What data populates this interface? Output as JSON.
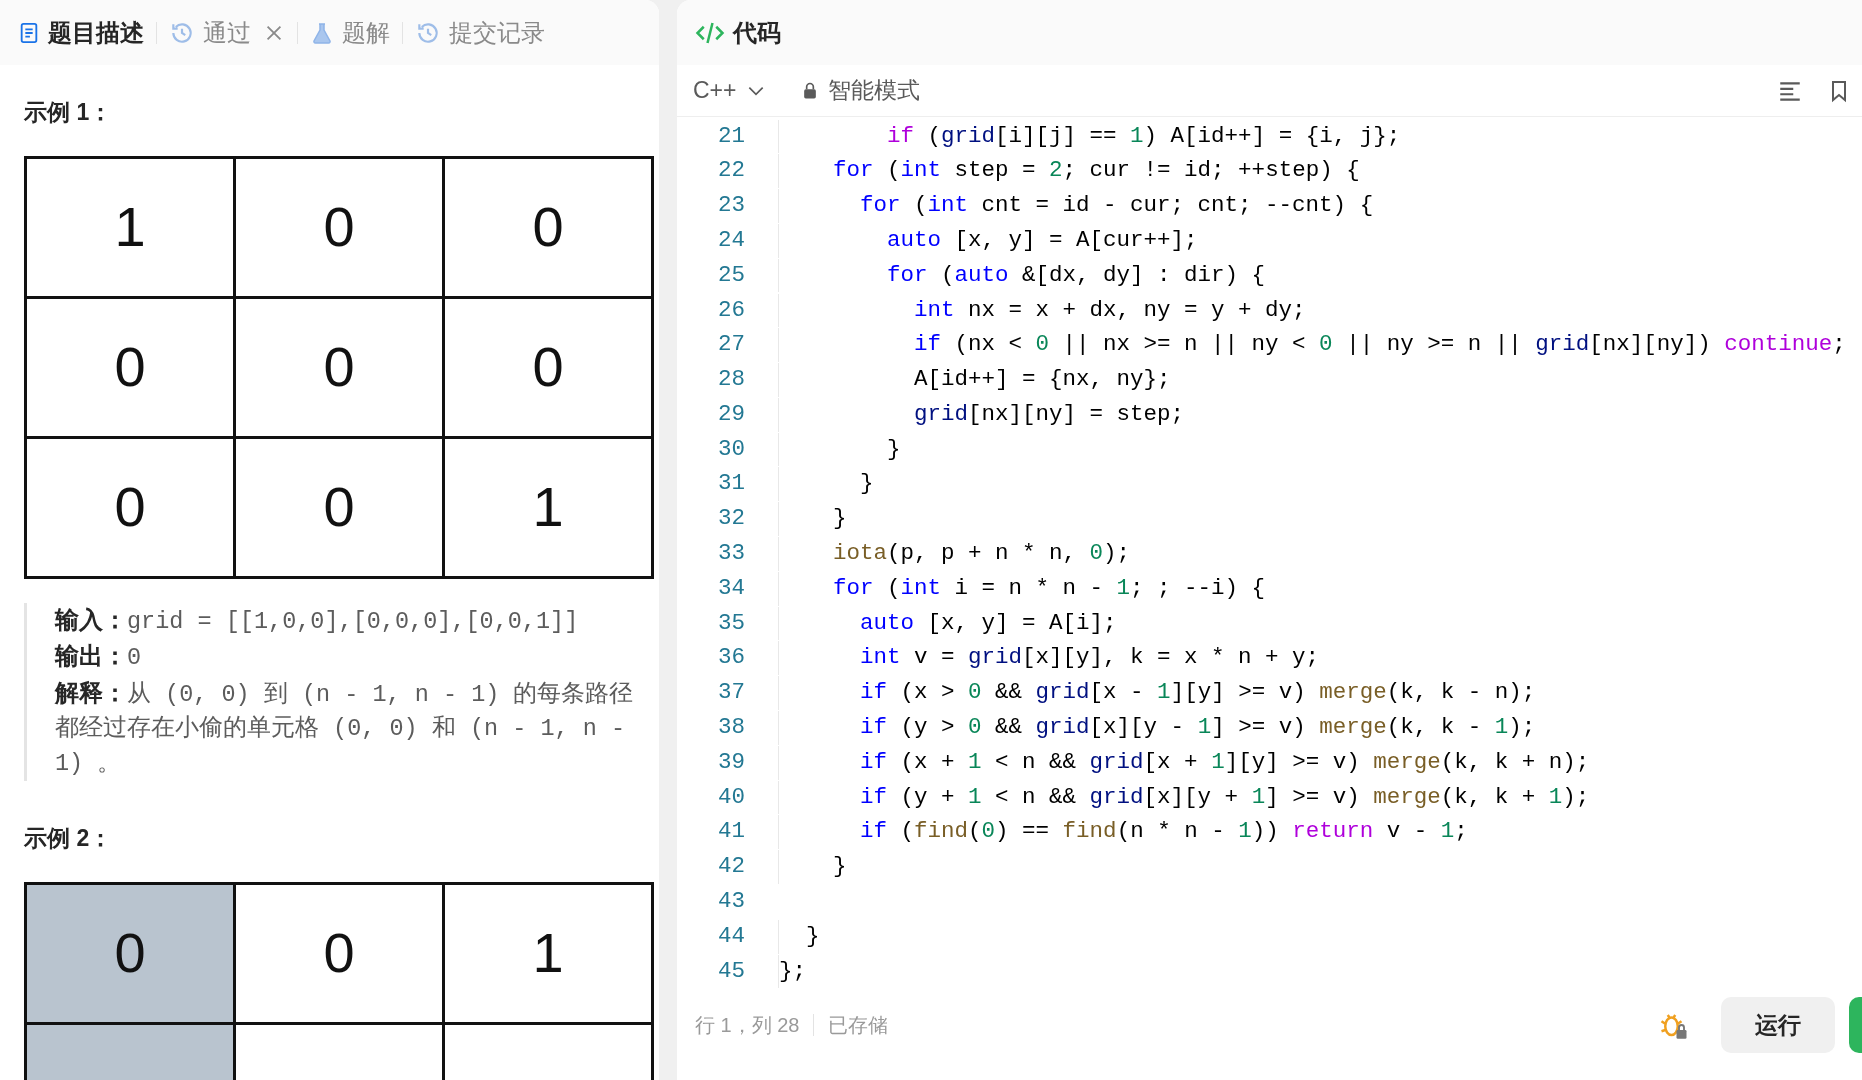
{
  "problem_panel": {
    "tabs": [
      {
        "label": "题目描述",
        "selected": true,
        "closable": false
      },
      {
        "label": "通过",
        "selected": false,
        "closable": true
      },
      {
        "label": "题解",
        "selected": false,
        "closable": false
      },
      {
        "label": "提交记录",
        "selected": false,
        "closable": false
      }
    ],
    "examples": [
      {
        "heading": "示例 1：",
        "grid": [
          [
            {
              "value": "1",
              "highlighted": false
            },
            {
              "value": "0",
              "highlighted": false
            },
            {
              "value": "0",
              "highlighted": false
            }
          ],
          [
            {
              "value": "0",
              "highlighted": false
            },
            {
              "value": "0",
              "highlighted": false
            },
            {
              "value": "0",
              "highlighted": false
            }
          ],
          [
            {
              "value": "0",
              "highlighted": false
            },
            {
              "value": "0",
              "highlighted": false
            },
            {
              "value": "1",
              "highlighted": false
            }
          ]
        ],
        "details": [
          "**输入：**grid = [[1,0,0],[0,0,0],[0,0,1]]",
          "**输出：**0",
          "**解释：**从 (0, 0) 到 (n - 1, n - 1) 的每条路径都经过存在小偷的单元格 (0, 0) 和 (n - 1, n - 1) 。"
        ]
      },
      {
        "heading": "示例 2：",
        "grid": [
          [
            {
              "value": "0",
              "highlighted": true
            },
            {
              "value": "0",
              "highlighted": false
            },
            {
              "value": "1",
              "highlighted": false
            }
          ],
          [
            {
              "highlighted": true
            },
            {
              "highlighted": false
            },
            {
              "highlighted": false
            }
          ]
        ]
      }
    ]
  },
  "editor": {
    "title": "代码",
    "language": "C++",
    "mode": "智能模式",
    "lines": [
      {
        "number": "21",
        "tokens": [
          {
            "text": "        if",
            "kind": "control"
          },
          {
            "text": " ("
          },
          {
            "text": "grid",
            "kind": "variable"
          },
          {
            "text": "[i][j] == "
          },
          {
            "text": "1",
            "kind": "number"
          },
          {
            "text": ") A[id++] = {i, j};"
          }
        ]
      },
      {
        "number": "22",
        "tokens": [
          {
            "text": "    for",
            "kind": "keyword"
          },
          {
            "text": " ("
          },
          {
            "text": "int",
            "kind": "keyword"
          },
          {
            "text": " step = "
          },
          {
            "text": "2",
            "kind": "number"
          },
          {
            "text": "; cur != id; ++step) {"
          }
        ]
      },
      {
        "number": "23",
        "tokens": [
          {
            "text": "      for",
            "kind": "keyword"
          },
          {
            "text": " ("
          },
          {
            "text": "int",
            "kind": "keyword"
          },
          {
            "text": " cnt = id - cur; cnt; --cnt) {"
          }
        ]
      },
      {
        "number": "24",
        "tokens": [
          {
            "text": "        auto",
            "kind": "keyword"
          },
          {
            "text": " [x, y] = A[cur++];"
          }
        ]
      },
      {
        "number": "25",
        "tokens": [
          {
            "text": "        for",
            "kind": "keyword"
          },
          {
            "text": " ("
          },
          {
            "text": "auto",
            "kind": "keyword"
          },
          {
            "text": " &[dx, dy] : dir) {"
          }
        ]
      },
      {
        "number": "26",
        "tokens": [
          {
            "text": "          int",
            "kind": "keyword"
          },
          {
            "text": " nx = x + dx, ny = y + dy;"
          }
        ]
      },
      {
        "number": "27",
        "tokens": [
          {
            "text": "          if",
            "kind": "keyword"
          },
          {
            "text": " (nx < "
          },
          {
            "text": "0",
            "kind": "number"
          },
          {
            "text": " || nx >= n || ny < "
          },
          {
            "text": "0",
            "kind": "number"
          },
          {
            "text": " || ny >= n || "
          },
          {
            "text": "grid",
            "kind": "variable"
          },
          {
            "text": "[nx][ny]) "
          },
          {
            "text": "continue",
            "kind": "control"
          },
          {
            "text": ";"
          }
        ]
      },
      {
        "number": "28",
        "tokens": [
          {
            "text": "          A[id++] = {nx, ny};"
          }
        ]
      },
      {
        "number": "29",
        "tokens": [
          {
            "text": "          grid",
            "kind": "variable"
          },
          {
            "text": "[nx][ny] = step;"
          }
        ]
      },
      {
        "number": "30",
        "tokens": [
          {
            "text": "        }"
          }
        ]
      },
      {
        "number": "31",
        "tokens": [
          {
            "text": "      }"
          }
        ]
      },
      {
        "number": "32",
        "tokens": [
          {
            "text": "    }"
          }
        ]
      },
      {
        "number": "33",
        "tokens": [
          {
            "text": "    iota",
            "kind": "function"
          },
          {
            "text": "(p, p + n * n, "
          },
          {
            "text": "0",
            "kind": "number"
          },
          {
            "text": ");"
          }
        ]
      },
      {
        "number": "34",
        "tokens": [
          {
            "text": "    for",
            "kind": "keyword"
          },
          {
            "text": " ("
          },
          {
            "text": "int",
            "kind": "keyword"
          },
          {
            "text": " i = n * n - "
          },
          {
            "text": "1",
            "kind": "number"
          },
          {
            "text": "; ; --i) {"
          }
        ]
      },
      {
        "number": "35",
        "tokens": [
          {
            "text": "      auto",
            "kind": "keyword"
          },
          {
            "text": " [x, y] = A[i];"
          }
        ]
      },
      {
        "number": "36",
        "tokens": [
          {
            "text": "      int",
            "kind": "keyword"
          },
          {
            "text": " v = "
          },
          {
            "text": "grid",
            "kind": "variable"
          },
          {
            "text": "[x][y], k = x * n + y;"
          }
        ]
      },
      {
        "number": "37",
        "tokens": [
          {
            "text": "      if",
            "kind": "keyword"
          },
          {
            "text": " (x > "
          },
          {
            "text": "0",
            "kind": "number"
          },
          {
            "text": " && "
          },
          {
            "text": "grid",
            "kind": "variable"
          },
          {
            "text": "[x - "
          },
          {
            "text": "1",
            "kind": "number"
          },
          {
            "text": "][y] >= v) "
          },
          {
            "text": "merge",
            "kind": "function"
          },
          {
            "text": "(k, k - n);"
          }
        ]
      },
      {
        "number": "38",
        "tokens": [
          {
            "text": "      if",
            "kind": "keyword"
          },
          {
            "text": " (y > "
          },
          {
            "text": "0",
            "kind": "number"
          },
          {
            "text": " && "
          },
          {
            "text": "grid",
            "kind": "variable"
          },
          {
            "text": "[x][y - "
          },
          {
            "text": "1",
            "kind": "number"
          },
          {
            "text": "] >= v) "
          },
          {
            "text": "merge",
            "kind": "function"
          },
          {
            "text": "(k, k - "
          },
          {
            "text": "1",
            "kind": "number"
          },
          {
            "text": ");"
          }
        ]
      },
      {
        "number": "39",
        "tokens": [
          {
            "text": "      if",
            "kind": "keyword"
          },
          {
            "text": " (x + "
          },
          {
            "text": "1",
            "kind": "number"
          },
          {
            "text": " < n && "
          },
          {
            "text": "grid",
            "kind": "variable"
          },
          {
            "text": "[x + "
          },
          {
            "text": "1",
            "kind": "number"
          },
          {
            "text": "][y] >= v) "
          },
          {
            "text": "merge",
            "kind": "function"
          },
          {
            "text": "(k, k + n);"
          }
        ]
      },
      {
        "number": "40",
        "tokens": [
          {
            "text": "      if",
            "kind": "keyword"
          },
          {
            "text": " (y + "
          },
          {
            "text": "1",
            "kind": "number"
          },
          {
            "text": " < n && "
          },
          {
            "text": "grid",
            "kind": "variable"
          },
          {
            "text": "[x][y + "
          },
          {
            "text": "1",
            "kind": "number"
          },
          {
            "text": "] >= v) "
          },
          {
            "text": "merge",
            "kind": "function"
          },
          {
            "text": "(k, k + "
          },
          {
            "text": "1",
            "kind": "number"
          },
          {
            "text": ");"
          }
        ]
      },
      {
        "number": "41",
        "tokens": [
          {
            "text": "      if",
            "kind": "keyword"
          },
          {
            "text": " ("
          },
          {
            "text": "find",
            "kind": "function"
          },
          {
            "text": "("
          },
          {
            "text": "0",
            "kind": "number"
          },
          {
            "text": ") == "
          },
          {
            "text": "find",
            "kind": "function"
          },
          {
            "text": "(n * n - "
          },
          {
            "text": "1",
            "kind": "number"
          },
          {
            "text": ")) "
          },
          {
            "text": "return",
            "kind": "control"
          },
          {
            "text": " v - "
          },
          {
            "text": "1",
            "kind": "number"
          },
          {
            "text": ";"
          }
        ]
      },
      {
        "number": "42",
        "tokens": [
          {
            "text": "    }"
          }
        ]
      },
      {
        "number": "43"
      },
      {
        "number": "44",
        "tokens": [
          {
            "text": "  }"
          }
        ]
      },
      {
        "number": "45",
        "tokens": [
          {
            "text": "};"
          }
        ]
      }
    ],
    "status": {
      "position": "行 1，列 28",
      "saved": "已存储"
    },
    "run_button": "运行"
  }
}
